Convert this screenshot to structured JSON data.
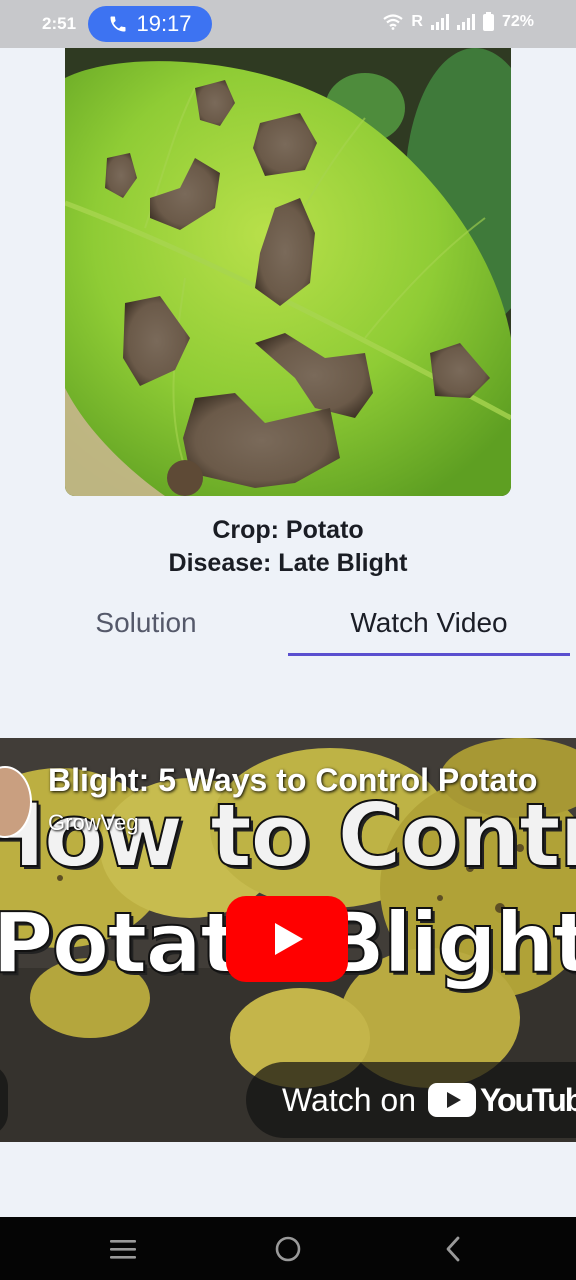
{
  "status_bar": {
    "time": "2:51",
    "call_timer": "19:17",
    "network_letter": "R",
    "battery": "72%",
    "icons": [
      "phone-icon",
      "wifi-icon",
      "signal-icon",
      "battery-icon"
    ]
  },
  "leaf_image": {
    "subject": "potato leaf with late blight lesions"
  },
  "diagnosis": {
    "crop_line": "Crop: Potato",
    "disease_line": "Disease: Late Blight"
  },
  "tabs": [
    {
      "label": "Solution",
      "selected": false
    },
    {
      "label": "Watch Video",
      "selected": true
    }
  ],
  "video": {
    "title": "Blight: 5 Ways to Control Potato",
    "channel": "GrowVeg",
    "thumbnail_line_1": "How to Control",
    "thumbnail_line_2": "Potato Blight",
    "watch_on": "Watch on",
    "platform": "YouTube",
    "platform_visible": "YouTub",
    "icons": [
      "play-icon",
      "youtube-icon"
    ]
  },
  "nav_bar": {
    "icons": [
      "menu-icon",
      "home-icon",
      "back-icon"
    ]
  },
  "colors": {
    "accent": "#5a4fcf",
    "call_pill": "#3d73f2",
    "youtube_red": "#ff0000",
    "status_bar_bg": "#c7c8cb",
    "nav_bar_bg": "#050505"
  }
}
